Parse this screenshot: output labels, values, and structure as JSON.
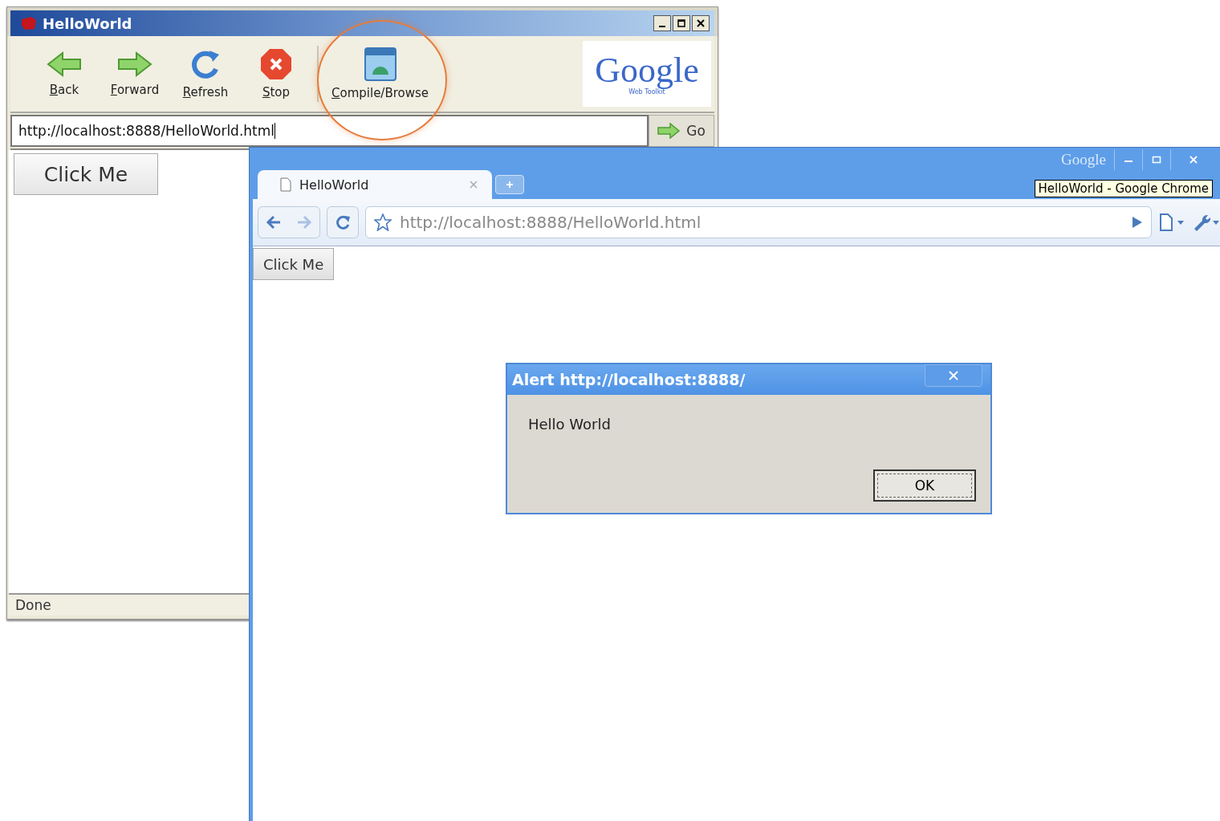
{
  "hosted_browser": {
    "title": "HelloWorld",
    "toolbar": [
      {
        "label": "Back",
        "kind": "back"
      },
      {
        "label": "Forward",
        "kind": "forward"
      },
      {
        "label": "Refresh",
        "kind": "refresh"
      },
      {
        "label": "Stop",
        "kind": "stop"
      },
      {
        "label": "Compile/Browse",
        "kind": "compile",
        "highlighted": true
      }
    ],
    "logo": {
      "name": "Google",
      "subtitle": "Web Toolkit"
    },
    "url": "http://localhost:8888/HelloWorld.html",
    "go_button": "Go",
    "page": {
      "button": "Click Me"
    },
    "status_bar": "Done"
  },
  "chrome": {
    "brand": "Google",
    "tabs": [
      {
        "title": "HelloWorld",
        "selected": true
      }
    ],
    "tooltip": "HelloWorld - Google Chrome",
    "url": "http://localhost:8888/HelloWorld.html",
    "page": {
      "button": "Click Me"
    }
  },
  "alert": {
    "title": "Alert http://localhost:8888/",
    "message": "Hello World",
    "button": "OK"
  }
}
